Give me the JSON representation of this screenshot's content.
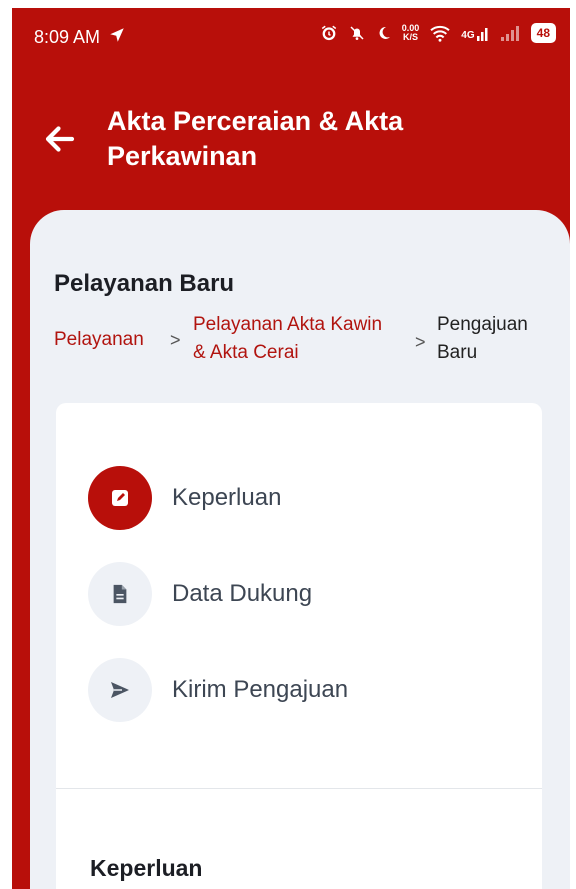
{
  "status_bar": {
    "time": "8:09 AM",
    "net_speed_top": "0.00",
    "net_speed_bottom": "K/S",
    "network": "4G",
    "battery": "48"
  },
  "header": {
    "title": "Akta Perceraian & Akta Perkawinan"
  },
  "page": {
    "section_title": "Pelayanan Baru",
    "breadcrumb": [
      {
        "label": "Pelayanan"
      },
      {
        "label": "Pelayanan Akta Kawin & Akta Cerai"
      },
      {
        "label": "Pengajuan Baru"
      }
    ],
    "breadcrumb_separator": ">"
  },
  "steps": [
    {
      "label": "Keperluan",
      "icon": "edit-icon",
      "active": true
    },
    {
      "label": "Data Dukung",
      "icon": "document-icon",
      "active": false
    },
    {
      "label": "Kirim Pengajuan",
      "icon": "send-icon",
      "active": false
    }
  ],
  "form": {
    "section_label": "Keperluan"
  },
  "colors": {
    "brand": "#b80f0a",
    "surface": "#eef1f6",
    "link": "#b1140f"
  }
}
